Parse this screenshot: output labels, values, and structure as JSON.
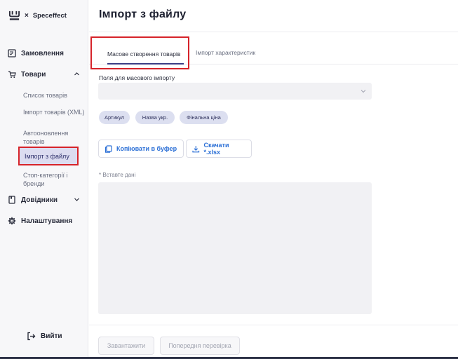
{
  "brand": {
    "x": "×",
    "name": "Speceffect"
  },
  "nav": {
    "orders": "Замовлення",
    "goods": "Товари",
    "goods_sub": [
      "Список товарів",
      "Імпорт товарів (XML)",
      "Автооновлення товарів",
      "Імпорт з файлу",
      "Стоп-категорії і бренди"
    ],
    "directories": "Довідники",
    "settings": "Налаштування"
  },
  "logout": "Вийти",
  "page": {
    "title": "Імпорт з файлу"
  },
  "tabs": {
    "active": "Масове створення товарів",
    "other": "Імпорт характеристик"
  },
  "fields": {
    "label": "Поля для масового імпорту",
    "select_value": ""
  },
  "chips": [
    "Артикул",
    "Назва укр.",
    "Фінальна ціна"
  ],
  "actions": {
    "copy": "Копіювати в буфер",
    "download": "Скачати *.xlsx"
  },
  "paste": {
    "label": "* Вставте дані",
    "value": ""
  },
  "footer": {
    "upload": "Завантажити",
    "precheck": "Попередня перевірка"
  },
  "colors": {
    "accent": "#2b6fd6",
    "highlight": "#d6232a",
    "active_tab": "#3b3f86"
  }
}
